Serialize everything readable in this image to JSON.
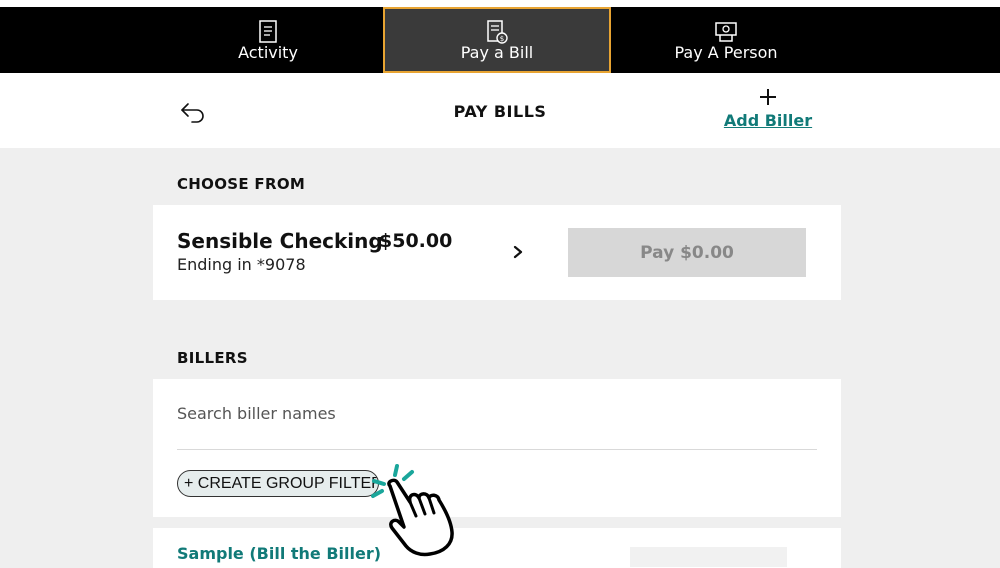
{
  "nav": {
    "tabs": [
      {
        "label": "Activity",
        "icon": "receipt-icon"
      },
      {
        "label": "Pay a Bill",
        "icon": "bill-dollar-icon",
        "active": true
      },
      {
        "label": "Pay A Person",
        "icon": "cash-icon"
      }
    ]
  },
  "header": {
    "title": "PAY BILLS",
    "add_label": "Add Biller",
    "back_icon": "back-arrow-icon",
    "add_icon": "plus-icon"
  },
  "choose": {
    "label": "CHOOSE FROM",
    "account_name": "Sensible Checking",
    "balance": "$50.00",
    "ending": "Ending in *9078",
    "pay_label": "Pay $0.00"
  },
  "billers": {
    "label": "BILLERS",
    "search_placeholder": "Search biller names",
    "group_filter_label": "+ CREATE GROUP FILTER",
    "first_biller": "Sample (Bill the Biller)"
  },
  "colors": {
    "accent_teal": "#117a78",
    "active_tab_border": "#e8a432",
    "nav_bg": "#000000",
    "cursor_spark": "#1aa69b"
  }
}
